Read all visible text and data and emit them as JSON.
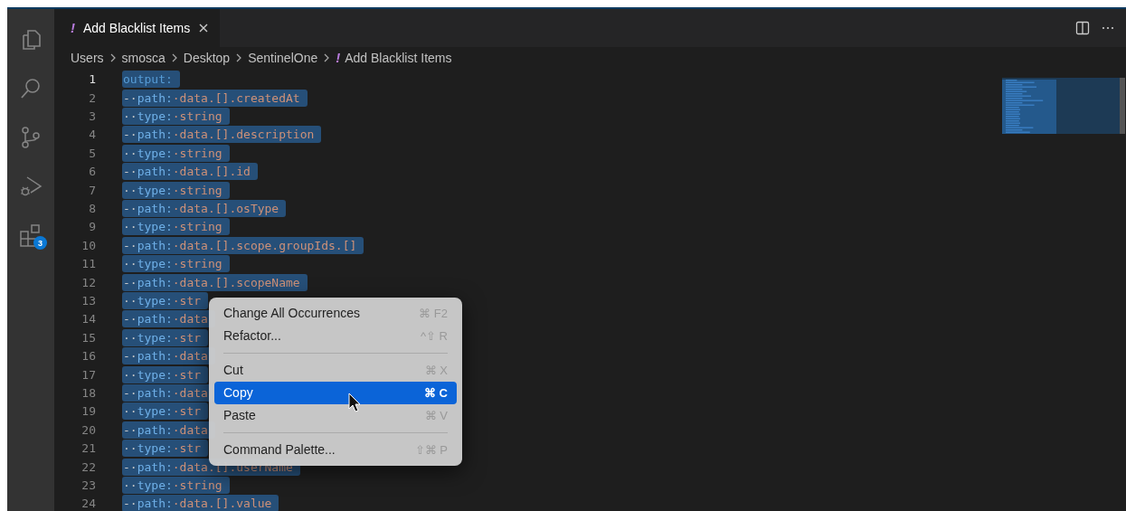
{
  "activity_bar": {
    "items": [
      {
        "kind": "explorer",
        "selected": false
      },
      {
        "kind": "search",
        "selected": false
      },
      {
        "kind": "scm",
        "selected": false
      },
      {
        "kind": "debug",
        "selected": false
      },
      {
        "kind": "extensions",
        "selected": false,
        "badge": "3"
      }
    ]
  },
  "tabs": [
    {
      "icon": "!",
      "label": "Add Blacklist Items",
      "selected": true
    }
  ],
  "breadcrumbs": [
    {
      "label": "Users"
    },
    {
      "label": "smosca"
    },
    {
      "label": "Desktop"
    },
    {
      "label": "SentinelOne"
    },
    {
      "icon": "!",
      "label": "Add Blacklist Items"
    }
  ],
  "editor": {
    "lines": [
      {
        "number": "1",
        "current": true,
        "key": "output:"
      },
      {
        "number": "2",
        "current": false,
        "lead": "-·",
        "key": "path:",
        "value": "·data.[].createdAt"
      },
      {
        "number": "3",
        "current": false,
        "lead": "··",
        "key": "type:",
        "value": "·string"
      },
      {
        "number": "4",
        "current": false,
        "lead": "-·",
        "key": "path:",
        "value": "·data.[].description"
      },
      {
        "number": "5",
        "current": false,
        "lead": "··",
        "key": "type:",
        "value": "·string"
      },
      {
        "number": "6",
        "current": false,
        "lead": "-·",
        "key": "path:",
        "value": "·data.[].id"
      },
      {
        "number": "7",
        "current": false,
        "lead": "··",
        "key": "type:",
        "value": "·string"
      },
      {
        "number": "8",
        "current": false,
        "lead": "-·",
        "key": "path:",
        "value": "·data.[].osType"
      },
      {
        "number": "9",
        "current": false,
        "lead": "··",
        "key": "type:",
        "value": "·string"
      },
      {
        "number": "10",
        "current": false,
        "lead": "-·",
        "key": "path:",
        "value": "·data.[].scope.groupIds.[]"
      },
      {
        "number": "11",
        "current": false,
        "lead": "··",
        "key": "type:",
        "value": "·string"
      },
      {
        "number": "12",
        "current": false,
        "lead": "-·",
        "key": "path:",
        "value": "·data.[].scopeName"
      },
      {
        "number": "13",
        "current": false,
        "lead": "··",
        "key": "type:",
        "value": "·str"
      },
      {
        "number": "14",
        "current": false,
        "lead": "-·",
        "key": "path:",
        "value": "·data"
      },
      {
        "number": "15",
        "current": false,
        "lead": "··",
        "key": "type:",
        "value": "·str"
      },
      {
        "number": "16",
        "current": false,
        "lead": "-·",
        "key": "path:",
        "value": "·data"
      },
      {
        "number": "17",
        "current": false,
        "lead": "··",
        "key": "type:",
        "value": "·str"
      },
      {
        "number": "18",
        "current": false,
        "lead": "-·",
        "key": "path:",
        "value": "·data"
      },
      {
        "number": "19",
        "current": false,
        "lead": "··",
        "key": "type:",
        "value": "·str"
      },
      {
        "number": "20",
        "current": false,
        "lead": "-·",
        "key": "path:",
        "value": "·data"
      },
      {
        "number": "21",
        "current": false,
        "lead": "··",
        "key": "type:",
        "value": "·str"
      },
      {
        "number": "22",
        "current": false,
        "lead": "-·",
        "key": "path:",
        "value": "·data.[].userName"
      },
      {
        "number": "23",
        "current": false,
        "lead": "··",
        "key": "type:",
        "value": "·string"
      },
      {
        "number": "24",
        "current": false,
        "lead": "-·",
        "key": "path:",
        "value": "·data.[].value"
      }
    ]
  },
  "context_menu": {
    "items": [
      {
        "kind": "item",
        "label": "Change All Occurrences",
        "shortcut": "⌘ F2",
        "selected": false
      },
      {
        "kind": "item",
        "label": "Refactor...",
        "shortcut": "^⇧ R",
        "selected": false
      },
      {
        "kind": "separator"
      },
      {
        "kind": "item",
        "label": "Cut",
        "shortcut": "⌘ X",
        "selected": false
      },
      {
        "kind": "item",
        "label": "Copy",
        "shortcut": "⌘ C",
        "selected": true
      },
      {
        "kind": "item",
        "label": "Paste",
        "shortcut": "⌘ V",
        "selected": false
      },
      {
        "kind": "separator"
      },
      {
        "kind": "item",
        "label": "Command Palette...",
        "shortcut": "⇧⌘ P",
        "selected": false
      }
    ]
  }
}
